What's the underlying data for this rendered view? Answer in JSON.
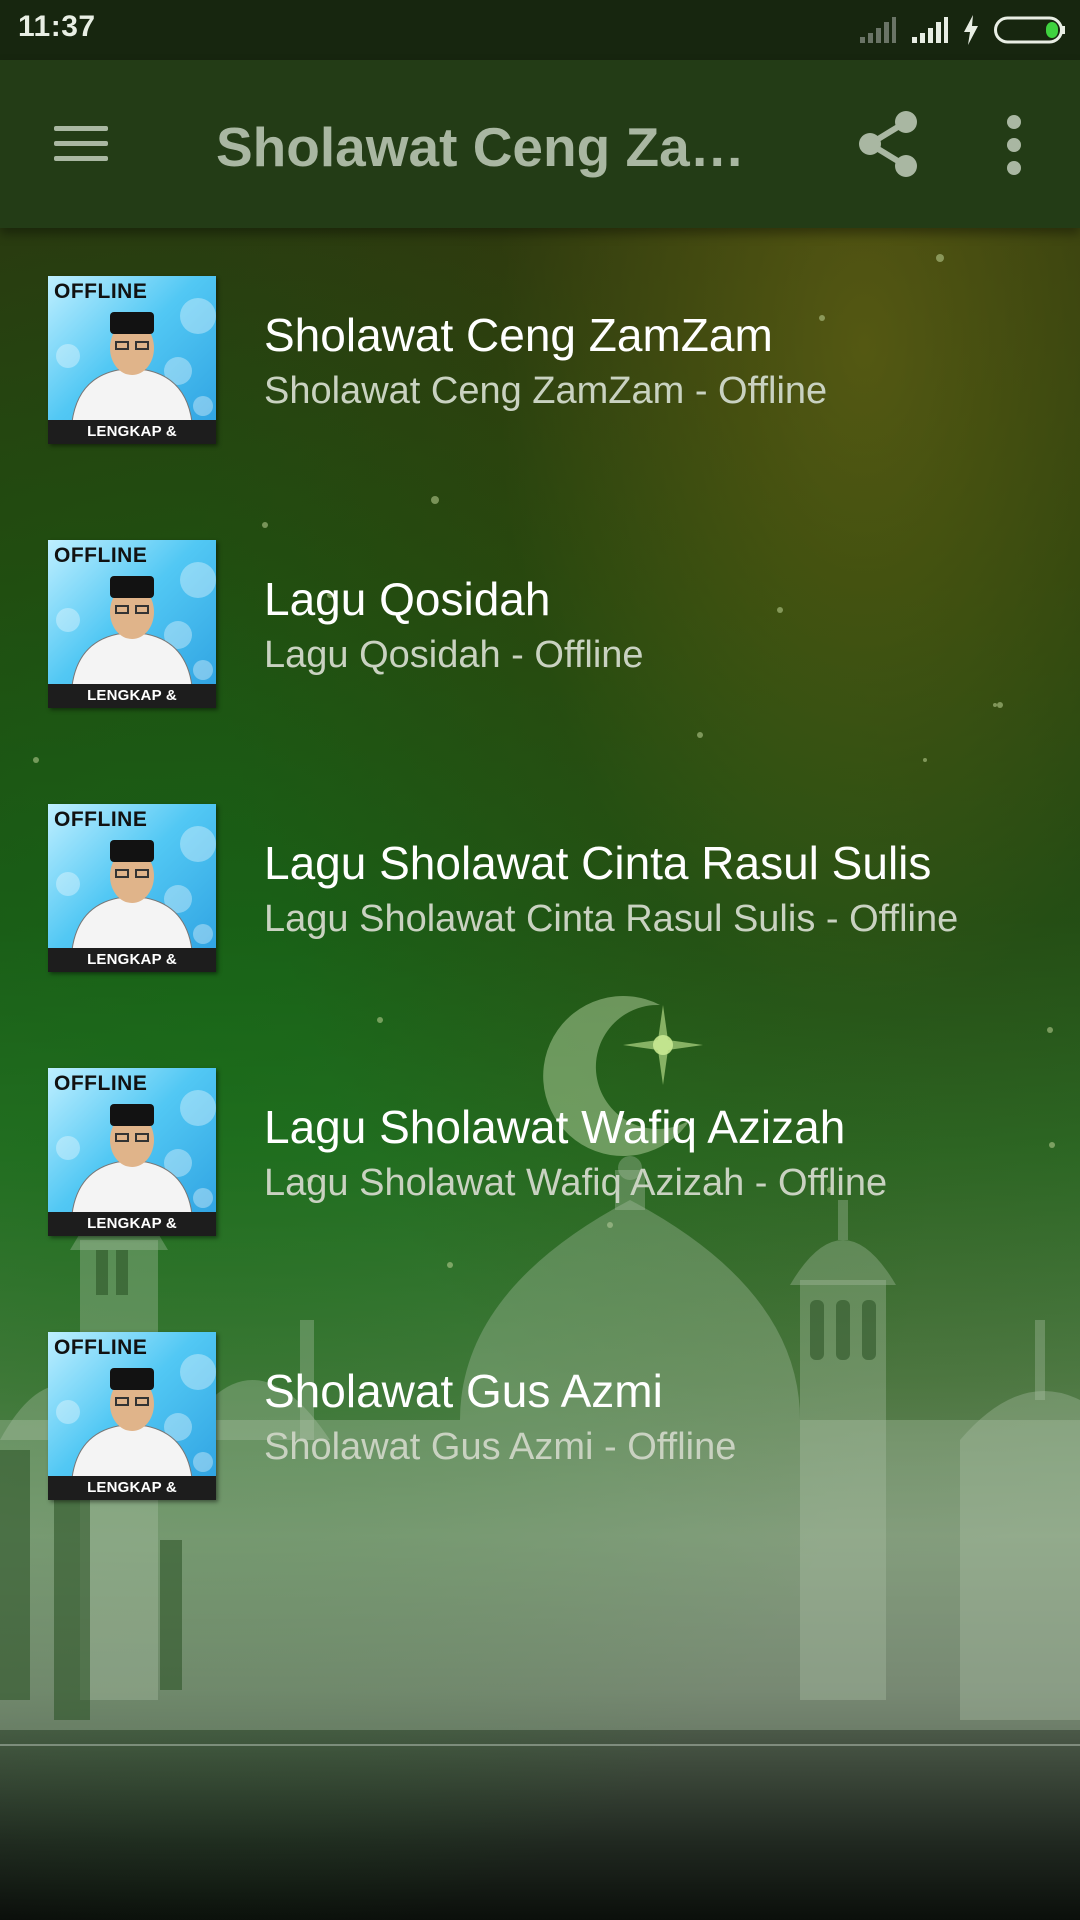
{
  "status_bar": {
    "time": "11:37",
    "icons": [
      "signal-weak-icon",
      "signal-icon",
      "charging-icon",
      "battery-icon"
    ],
    "battery_color": "#3fd23f"
  },
  "app_bar": {
    "title": "Sholawat Ceng ZamZam",
    "icons": [
      "menu-icon",
      "share-icon",
      "more-vert-icon"
    ],
    "color": "#233c16"
  },
  "thumbnail": {
    "top_text": "OFFLINE",
    "bottom_text": "LENGKAP & TERBARU"
  },
  "songs": [
    {
      "title": "Sholawat Ceng ZamZam",
      "subtitle": "Sholawat Ceng ZamZam - Offline"
    },
    {
      "title": "Lagu Qosidah",
      "subtitle": "Lagu Qosidah - Offline"
    },
    {
      "title": "Lagu Sholawat Cinta Rasul Sulis",
      "subtitle": "Lagu Sholawat Cinta Rasul Sulis - Offline"
    },
    {
      "title": "Lagu Sholawat Wafiq Azizah",
      "subtitle": "Lagu Sholawat Wafiq Azizah - Offline"
    },
    {
      "title": "Sholawat Gus Azmi",
      "subtitle": "Sholawat Gus Azmi - Offline"
    }
  ]
}
